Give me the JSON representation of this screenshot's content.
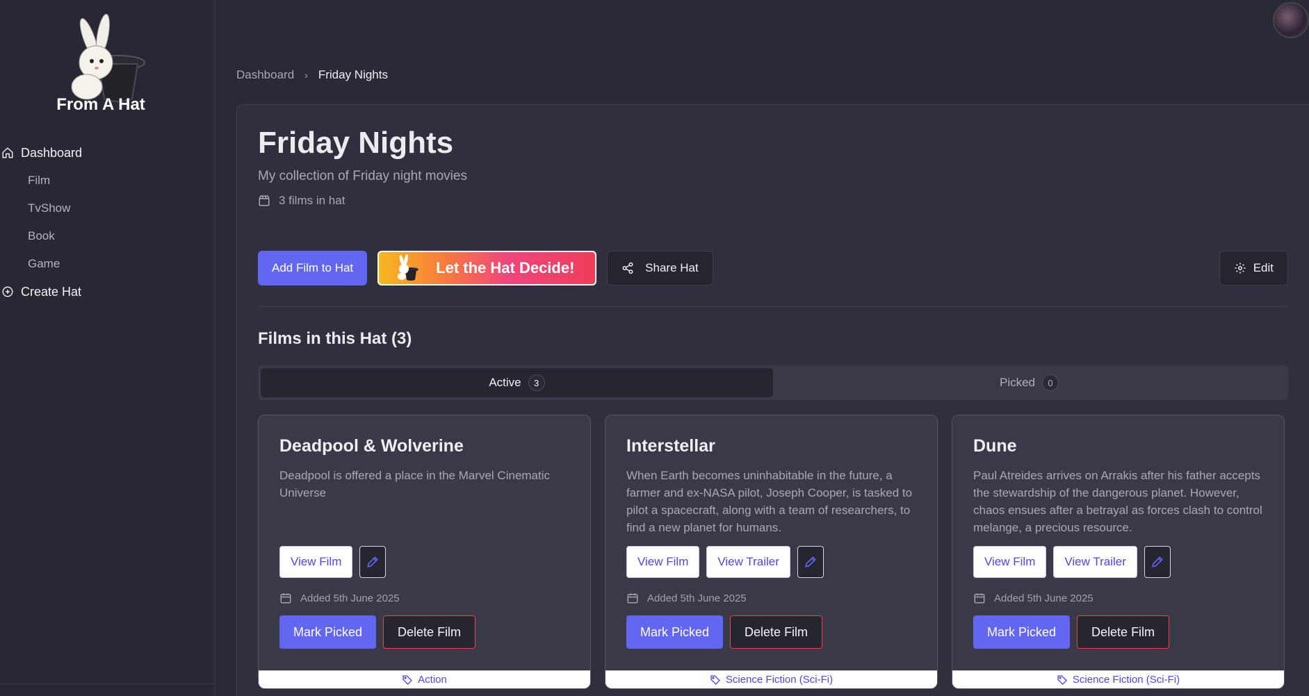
{
  "app": {
    "name": "From A Hat"
  },
  "sidebar": {
    "items": [
      {
        "label": "Dashboard",
        "icon": "home-icon"
      },
      {
        "label": "Film"
      },
      {
        "label": "TvShow"
      },
      {
        "label": "Book"
      },
      {
        "label": "Game"
      },
      {
        "label": "Create Hat",
        "icon": "plus-circle-icon"
      }
    ]
  },
  "breadcrumb": {
    "root": "Dashboard",
    "current": "Friday Nights"
  },
  "hat": {
    "title": "Friday Nights",
    "description": "My collection of Friday night movies",
    "count_label": "3 films in hat"
  },
  "actions": {
    "add_label": "Add Film to Hat",
    "decide_label": "Let the Hat Decide!",
    "share_label": "Share Hat",
    "edit_label": "Edit"
  },
  "section": {
    "title": "Films in this Hat (3)"
  },
  "tabs": [
    {
      "label": "Active",
      "count": "3"
    },
    {
      "label": "Picked",
      "count": "0"
    }
  ],
  "films": [
    {
      "title": "Deadpool & Wolverine",
      "description": "Deadpool is offered a place in the Marvel Cinematic Universe",
      "view_label": "View Film",
      "added": "Added 5th June 2025",
      "mark_label": "Mark Picked",
      "delete_label": "Delete Film",
      "genre": "Action"
    },
    {
      "title": "Interstellar",
      "description": "When Earth becomes uninhabitable in the future, a farmer and ex-NASA pilot, Joseph Cooper, is tasked to pilot a spacecraft, along with a team of researchers, to find a new planet for humans.",
      "view_label": "View Film",
      "trailer_label": "View Trailer",
      "added": "Added 5th June 2025",
      "mark_label": "Mark Picked",
      "delete_label": "Delete Film",
      "genre": "Science Fiction (Sci-Fi)"
    },
    {
      "title": "Dune",
      "description": "Paul Atreides arrives on Arrakis after his father accepts the stewardship of the dangerous planet. However, chaos ensues after a betrayal as forces clash to control melange, a precious resource.",
      "view_label": "View Film",
      "trailer_label": "View Trailer",
      "added": "Added 5th June 2025",
      "mark_label": "Mark Picked",
      "delete_label": "Delete Film",
      "genre": "Science Fiction (Sci-Fi)"
    }
  ],
  "colors": {
    "accent": "#6366f1",
    "danger": "#ef4444",
    "background": "#2a2a37"
  }
}
